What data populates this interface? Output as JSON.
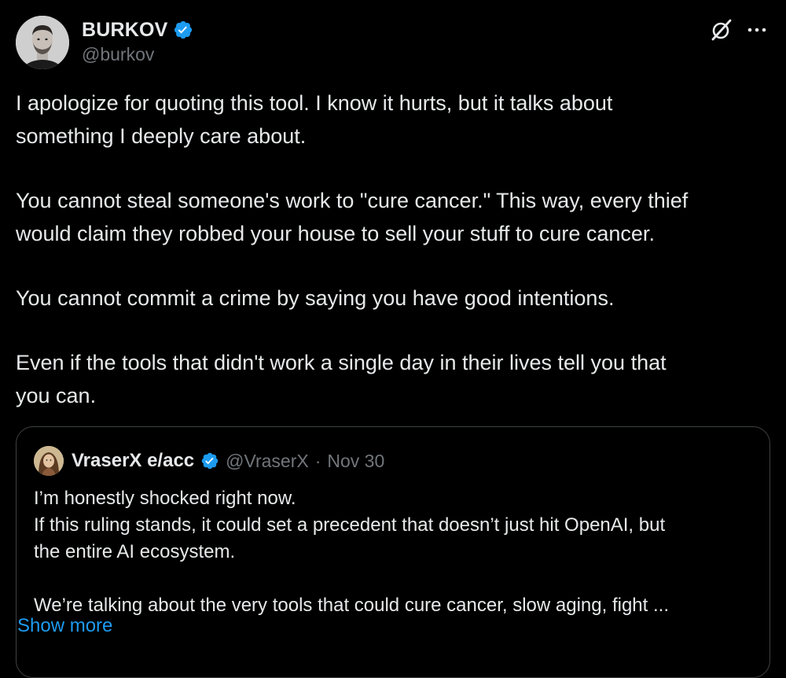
{
  "tweet": {
    "author": {
      "display_name": "BURKOV",
      "handle": "@burkov",
      "verified": true
    },
    "paragraphs": [
      "I apologize for quoting this tool. I know it hurts, but it talks about\nsomething I deeply care about.",
      "You cannot steal someone's work to \"cure cancer.\" This way, every thief\nwould claim they robbed your house to sell your stuff to cure cancer.",
      "You cannot commit a crime by saying you have good intentions.",
      "Even if the tools that didn't work a single day in their lives tell you that\nyou can."
    ],
    "icons": {
      "grok": "grok-icon",
      "more": "more-icon",
      "verified": "verified-badge-icon"
    }
  },
  "quote": {
    "author": {
      "display_name": "VraserX e/acc",
      "handle": "@VraserX",
      "separator": "·",
      "date": "Nov 30",
      "verified": true
    },
    "paragraphs": [
      "I’m honestly shocked right now.\nIf this ruling stands, it could set a precedent that doesn’t just hit OpenAI, but\nthe entire AI ecosystem.",
      "We’re talking about the very tools that could cure cancer, slow aging, fight ..."
    ],
    "show_more_label": "Show more"
  },
  "colors": {
    "background": "#000000",
    "text": "#e7e9ea",
    "secondary_text": "#71767b",
    "accent": "#1d9bf0",
    "border": "#3e4144"
  }
}
